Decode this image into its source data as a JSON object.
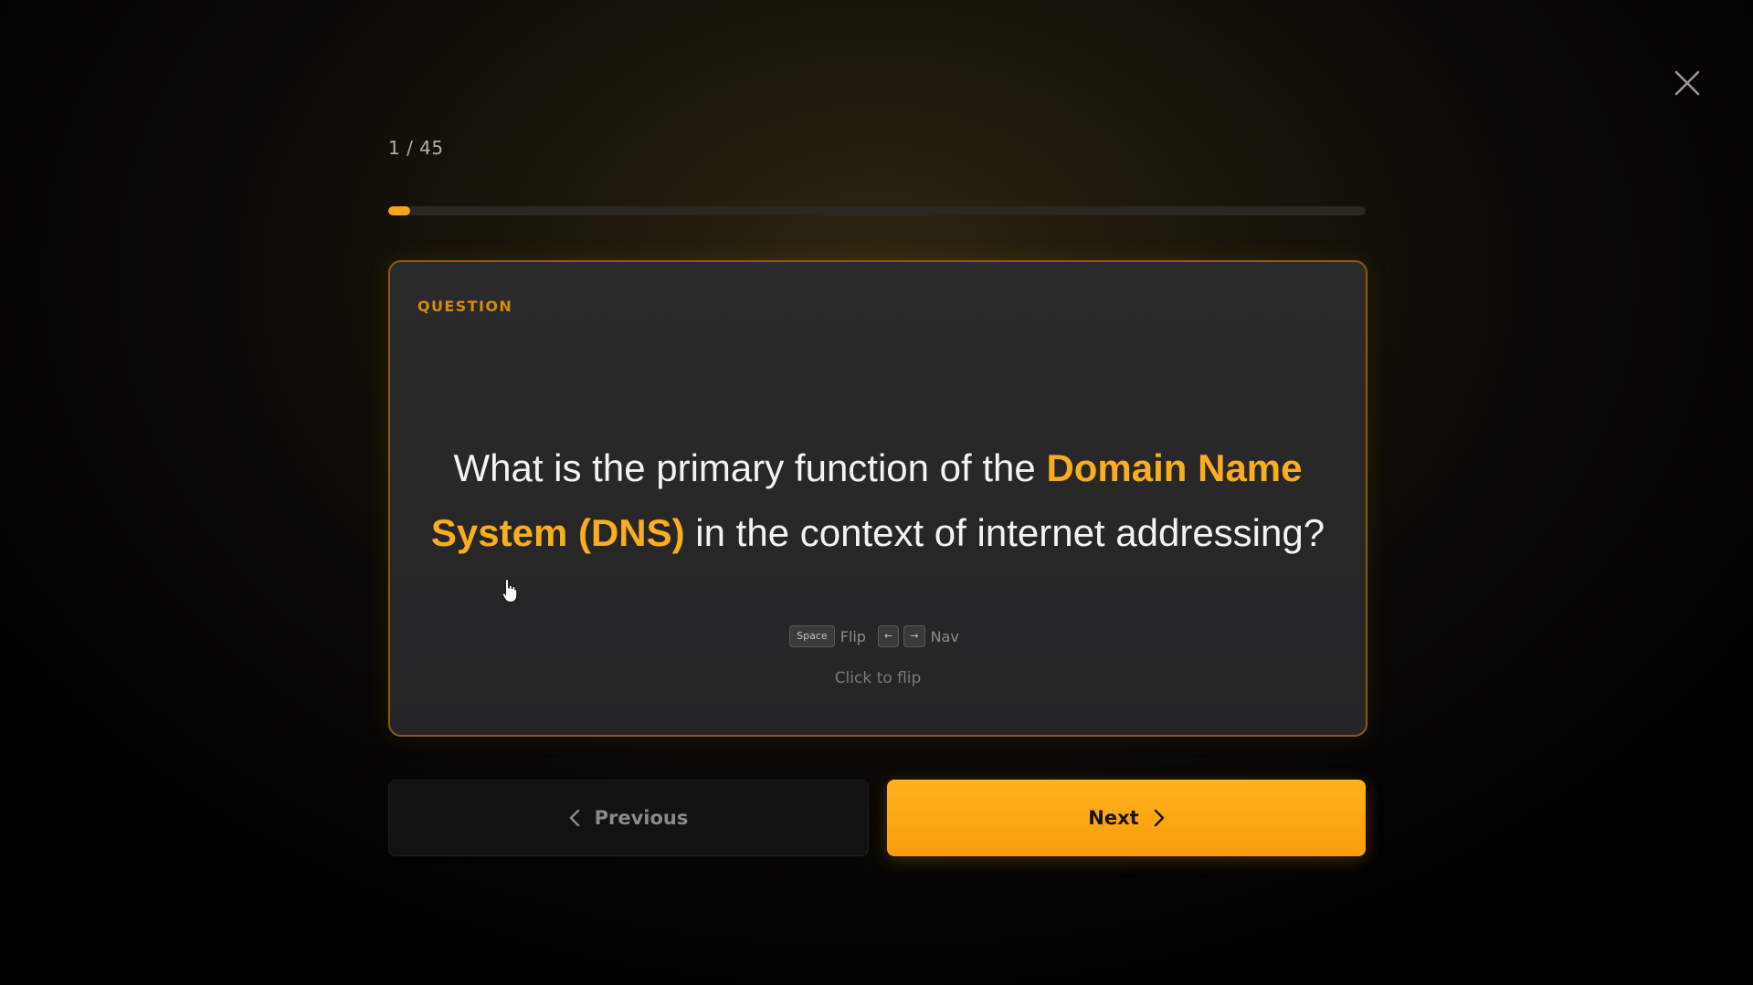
{
  "progress": {
    "counter_text": "1 / 45",
    "current": 1,
    "total": 45,
    "fraction": 0.022
  },
  "card": {
    "label": "QUESTION",
    "question_parts": [
      "What is the primary function of the ",
      "Domain Name System (DNS)",
      " in the context of internet addressing?"
    ],
    "hints": {
      "flip_key": "Space",
      "flip_label": "Flip",
      "nav_key_left": "←",
      "nav_key_right": "→",
      "nav_label": "Nav"
    },
    "click_hint": "Click to flip"
  },
  "buttons": {
    "previous_label": "Previous",
    "next_label": "Next"
  },
  "colors": {
    "accent": "#f7a416",
    "highlight_text": "#f9ad1f",
    "card_border": "#8a5a12"
  },
  "icons": {
    "close": "close-icon",
    "previous": "chevron-left-icon",
    "next": "chevron-right-icon",
    "cursor": "hand-pointer-icon"
  }
}
